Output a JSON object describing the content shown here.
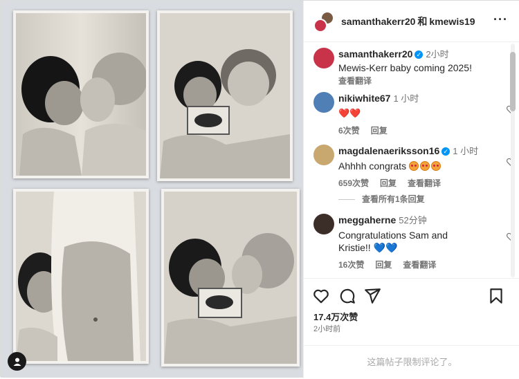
{
  "header": {
    "user1": "samanthakerr20",
    "conjunction": "和",
    "user2": "kmewis19",
    "more": "···"
  },
  "caption": {
    "username": "samanthakerr20",
    "time": "2小时",
    "text": "Mewis-Kerr baby coming 2025!",
    "translate": "查看翻译"
  },
  "comments": [
    {
      "username": "nikiwhite67",
      "time": "1 小时",
      "text": "❤️❤️",
      "likes": "6次赞",
      "reply": "回复"
    },
    {
      "username": "magdalenaeriksson16",
      "time": "1 小时",
      "text": "Ahhhh congrats",
      "likes": "659次赞",
      "reply": "回复",
      "translate": "查看翻译",
      "view_replies": "查看所有1条回复"
    },
    {
      "username": "meggaherne",
      "time": "52分钟",
      "text_line1": "Congratulations Sam and",
      "text_line2": "Kristie!!",
      "likes": "16次赞",
      "reply": "回复",
      "translate": "查看翻译"
    }
  ],
  "footer": {
    "likes": "17.4万次赞",
    "posted": "2小时前",
    "limited": "这篇帖子限制评论了。"
  },
  "icons": {
    "like": "heart-outline-icon",
    "comment": "comment-bubble-icon",
    "share": "paper-plane-icon",
    "save": "bookmark-icon",
    "tag": "person-tag-icon"
  },
  "colors": {
    "verified": "#0095f6",
    "heart": "#ed4956",
    "secondary_text": "#737373"
  }
}
